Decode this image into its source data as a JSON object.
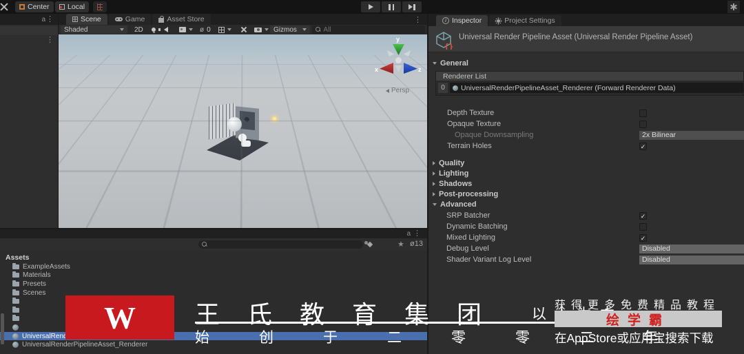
{
  "toolbar": {
    "center_label": "Center",
    "local_label": "Local"
  },
  "tabs": {
    "scene": "Scene",
    "game": "Game",
    "asset_store": "Asset Store"
  },
  "scene_toolbar": {
    "shading_mode": "Shaded",
    "mode_2d": "2D",
    "hidden_count": "0",
    "gizmos_label": "Gizmos",
    "search_placeholder": "All"
  },
  "viewport": {
    "axis_x": "x",
    "axis_y": "y",
    "axis_z": "z",
    "persp_label": "Persp"
  },
  "inspector": {
    "tab_inspector": "Inspector",
    "tab_project_settings": "Project Settings",
    "title": "Universal Render Pipeline Asset (Universal Render Pipeline Asset)",
    "general_label": "General",
    "renderer_list": {
      "header": "Renderer List",
      "index": "0",
      "item": "UniversalRenderPipelineAsset_Renderer (Forward Renderer Data)"
    },
    "general_props": [
      {
        "label": "Depth Texture",
        "mark": ""
      },
      {
        "label": "Opaque Texture",
        "mark": ""
      },
      {
        "label": "Opaque Downsampling",
        "value": "2x Bilinear"
      },
      {
        "label": "Terrain Holes",
        "mark": "✓"
      }
    ],
    "foldouts": [
      {
        "label": "Quality"
      },
      {
        "label": "Lighting"
      },
      {
        "label": "Shadows"
      },
      {
        "label": "Post-processing"
      }
    ],
    "advanced_label": "Advanced",
    "advanced_props": [
      {
        "label": "SRP Batcher",
        "mark": "✓"
      },
      {
        "label": "Dynamic Batching",
        "mark": ""
      },
      {
        "label": "Mixed Lighting",
        "mark": "✓"
      },
      {
        "label": "Debug Level",
        "value": "Disabled"
      },
      {
        "label": "Shader Variant Log Level",
        "value": "Disabled"
      }
    ]
  },
  "project": {
    "root_label": "Assets",
    "hidden_count": "13",
    "items": [
      {
        "label": "ExampleAssets",
        "type": "folder"
      },
      {
        "label": "Materials",
        "type": "folder"
      },
      {
        "label": "Presets",
        "type": "folder"
      },
      {
        "label": "Scenes",
        "type": "folder"
      },
      {
        "label": "",
        "type": "folder"
      },
      {
        "label": "",
        "type": "folder"
      },
      {
        "label": "",
        "type": "folder"
      },
      {
        "label": "",
        "type": "asset"
      },
      {
        "label": "UniversalRenderPipelineAsset",
        "type": "asset",
        "selected": true
      },
      {
        "label": "UniversalRenderPipelineAsset_Renderer",
        "type": "asset"
      }
    ]
  },
  "watermark": {
    "logo_letter": "W",
    "company": "王氏教育集团",
    "slogan": "以人为本",
    "founded": "始创于二零零二年",
    "promo_line1": "获得更多免费精品教程",
    "app_name": "绘学霸",
    "promo_line2": "在AppStore或应用宝搜索下载",
    "brand_red": "#c8191f"
  },
  "colors": {
    "selection_blue": "#4a6fae",
    "accent_orange": "#c77b3f",
    "urp_icon_teal": "#7fa7b2",
    "urp_icon_orange": "#e4573d"
  }
}
